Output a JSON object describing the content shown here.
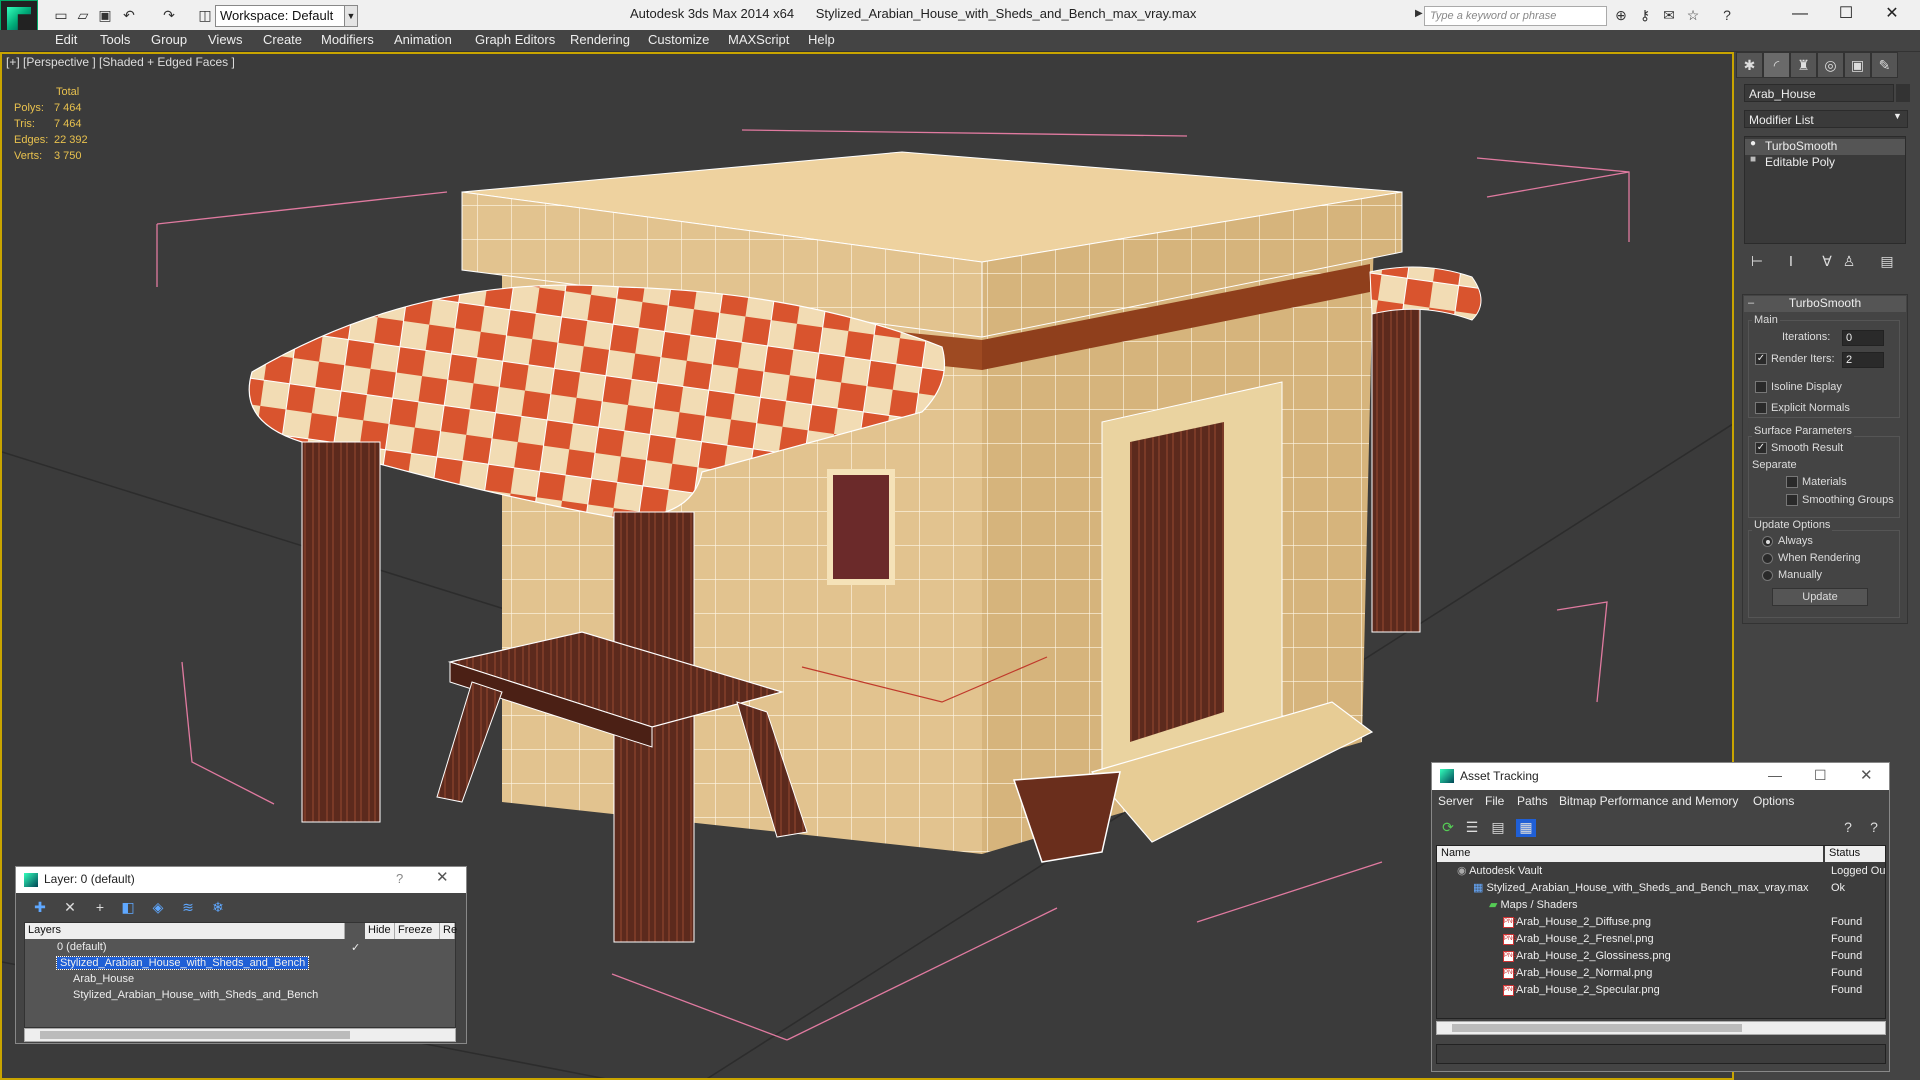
{
  "titlebar": {
    "workspace": "Workspace: Default",
    "app_name": "Autodesk 3ds Max  2014 x64",
    "file_name": "Stylized_Arabian_House_with_Sheds_and_Bench_max_vray.max",
    "search_placeholder": "Type a keyword or phrase"
  },
  "menu": [
    "Edit",
    "Tools",
    "Group",
    "Views",
    "Create",
    "Modifiers",
    "Animation",
    "Graph Editors",
    "Rendering",
    "Customize",
    "MAXScript",
    "Help"
  ],
  "viewport": {
    "label": "[+] [Perspective ] [Shaded + Edged Faces ]",
    "stats_header": "Total",
    "stats": [
      {
        "label": "Polys:",
        "value": "7 464"
      },
      {
        "label": "Tris:",
        "value": "7 464"
      },
      {
        "label": "Edges:",
        "value": "22 392"
      },
      {
        "label": "Verts:",
        "value": "3 750"
      }
    ]
  },
  "command_panel": {
    "object_name": "Arab_House",
    "modifier_list": "Modifier List",
    "stack": [
      "TurboSmooth",
      "Editable Poly"
    ],
    "rollout_title": "TurboSmooth",
    "main_group": "Main",
    "iterations_label": "Iterations:",
    "iterations_value": "0",
    "render_iters_label": "Render Iters:",
    "render_iters_value": "2",
    "isoline": "Isoline Display",
    "explicit_normals": "Explicit Normals",
    "surface_group": "Surface Parameters",
    "smooth_result": "Smooth Result",
    "separate": "Separate",
    "materials": "Materials",
    "smoothing_groups": "Smoothing Groups",
    "update_group": "Update Options",
    "always": "Always",
    "when_rendering": "When Rendering",
    "manually": "Manually",
    "update_button": "Update"
  },
  "layer_dialog": {
    "title": "Layer: 0 (default)",
    "help": "?",
    "columns": [
      "Layers",
      "Hide",
      "Freeze",
      "Re"
    ],
    "rows": [
      {
        "name": "0 (default)"
      },
      {
        "name": "Stylized_Arabian_House_with_Sheds_and_Bench"
      },
      {
        "name": "Arab_House"
      },
      {
        "name": "Stylized_Arabian_House_with_Sheds_and_Bench"
      }
    ]
  },
  "asset_dialog": {
    "title": "Asset Tracking",
    "menu": [
      "Server",
      "File",
      "Paths",
      "Bitmap Performance and Memory",
      "Options"
    ],
    "columns": [
      "Name",
      "Status"
    ],
    "rows": [
      {
        "name": "Autodesk Vault",
        "status": "Logged Ou"
      },
      {
        "name": "Stylized_Arabian_House_with_Sheds_and_Bench_max_vray.max",
        "status": "Ok"
      },
      {
        "name": "Maps / Shaders",
        "status": ""
      },
      {
        "name": "Arab_House_2_Diffuse.png",
        "status": "Found"
      },
      {
        "name": "Arab_House_2_Fresnel.png",
        "status": "Found"
      },
      {
        "name": "Arab_House_2_Glossiness.png",
        "status": "Found"
      },
      {
        "name": "Arab_House_2_Normal.png",
        "status": "Found"
      },
      {
        "name": "Arab_House_2_Specular.png",
        "status": "Found"
      }
    ]
  }
}
